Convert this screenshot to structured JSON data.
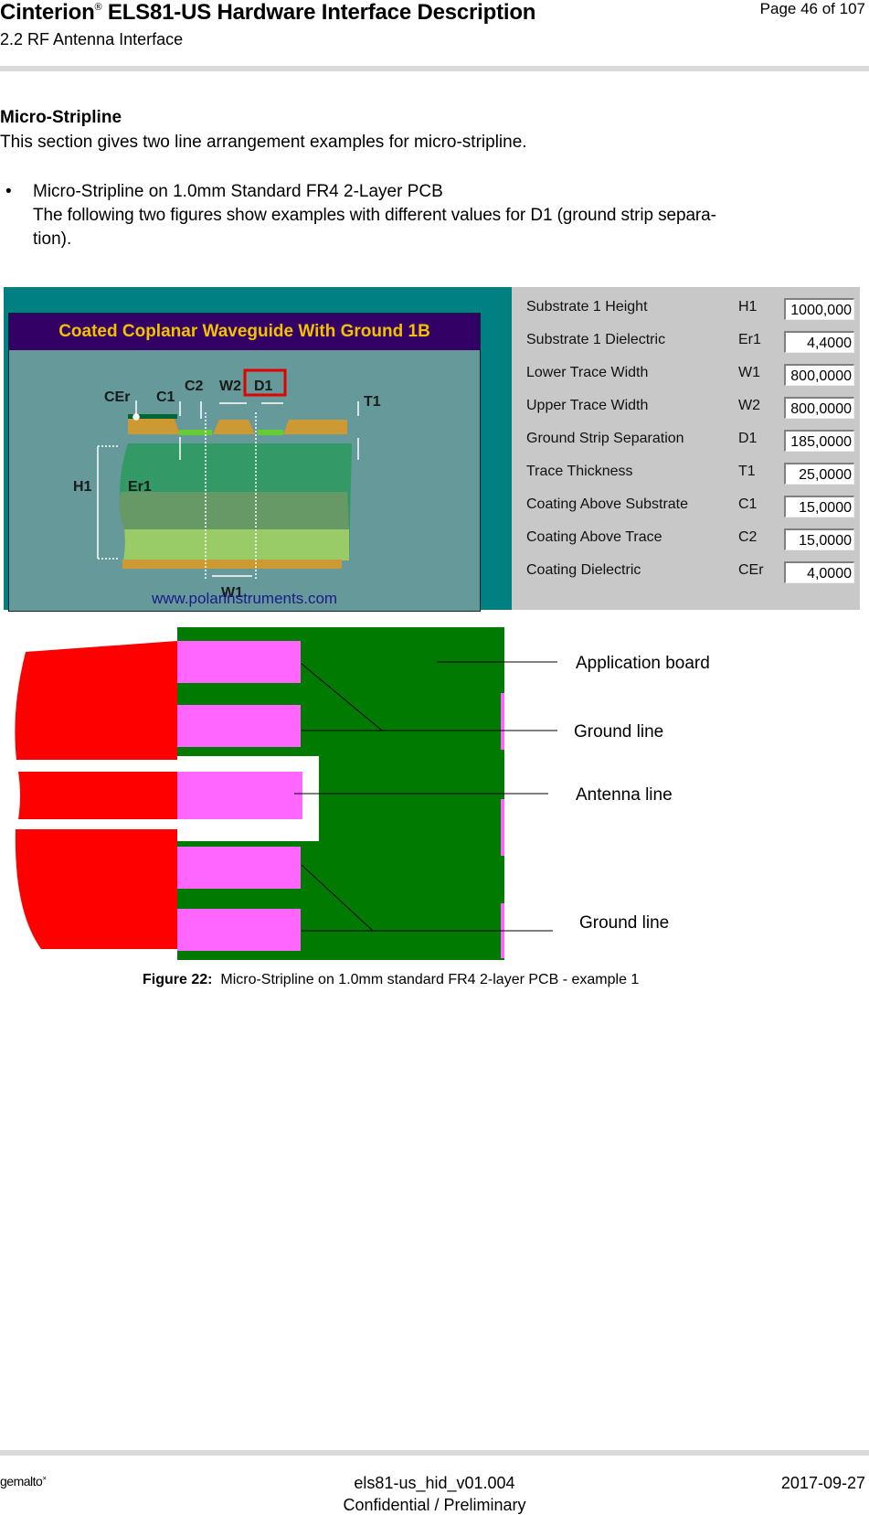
{
  "header": {
    "title_brand": "Cinterion",
    "title_reg": "®",
    "title_rest": " ELS81-US Hardware Interface Description",
    "subtitle": "2.2 RF Antenna Interface",
    "page": "Page 46 of 107"
  },
  "section": {
    "title": "Micro-Stripline",
    "intro": "This section gives two line arrangement examples for micro-stripline.",
    "bullet_marker": "•",
    "bullet_title": "Micro-Stripline on 1.0mm Standard FR4 2-Layer PCB",
    "bullet_text_1": "The following two figures show examples with different values for D1 (ground strip separa-",
    "bullet_text_2": "tion)."
  },
  "polar": {
    "title": "Coated Coplanar Waveguide With Ground 1B",
    "url": "www.polarinstruments.com",
    "diagram_labels": {
      "cer": "CEr",
      "c1": "C1",
      "c2": "C2",
      "w2": "W2",
      "d1": "D1",
      "t1": "T1",
      "h1": "H1",
      "er1": "Er1",
      "w1": "W1"
    },
    "highlighted_label": "D1",
    "colors": {
      "frame": "#008080",
      "panel": "#669999",
      "title_bg": "#330066",
      "title_text": "#f2c200",
      "highlight": "#e00000"
    }
  },
  "parameters": [
    {
      "label": "Substrate 1 Height",
      "symbol": "H1",
      "value": "1000,000"
    },
    {
      "label": "Substrate 1 Dielectric",
      "symbol": "Er1",
      "value": "4,4000"
    },
    {
      "label": "Lower Trace Width",
      "symbol": "W1",
      "value": "800,0000"
    },
    {
      "label": "Upper Trace Width",
      "symbol": "W2",
      "value": "800,0000"
    },
    {
      "label": "Ground Strip Separation",
      "symbol": "D1",
      "value": "185,0000"
    },
    {
      "label": "Trace Thickness",
      "symbol": "T1",
      "value": "25,0000"
    },
    {
      "label": "Coating Above Substrate",
      "symbol": "C1",
      "value": "15,0000"
    },
    {
      "label": "Coating Above Trace",
      "symbol": "C2",
      "value": "15,0000"
    },
    {
      "label": "Coating Dielectric",
      "symbol": "CEr",
      "value": "4,0000"
    }
  ],
  "pcb": {
    "labels": {
      "application_board": "Application board",
      "ground_line_top": "Ground line",
      "antenna_line": "Antenna line",
      "ground_line_bottom": "Ground line"
    },
    "colors": {
      "board": "#007a00",
      "module": "#ff0000",
      "pad": "#ff66ff"
    }
  },
  "caption": {
    "label": "Figure 22:",
    "text": "  Micro-Stripline on 1.0mm standard FR4 2-layer PCB - example 1"
  },
  "footer": {
    "logo": "gemalto",
    "logo_mark": "×",
    "doc_id": "els81-us_hid_v01.004",
    "confidentiality": "Confidential / Preliminary",
    "date": "2017-09-27"
  }
}
